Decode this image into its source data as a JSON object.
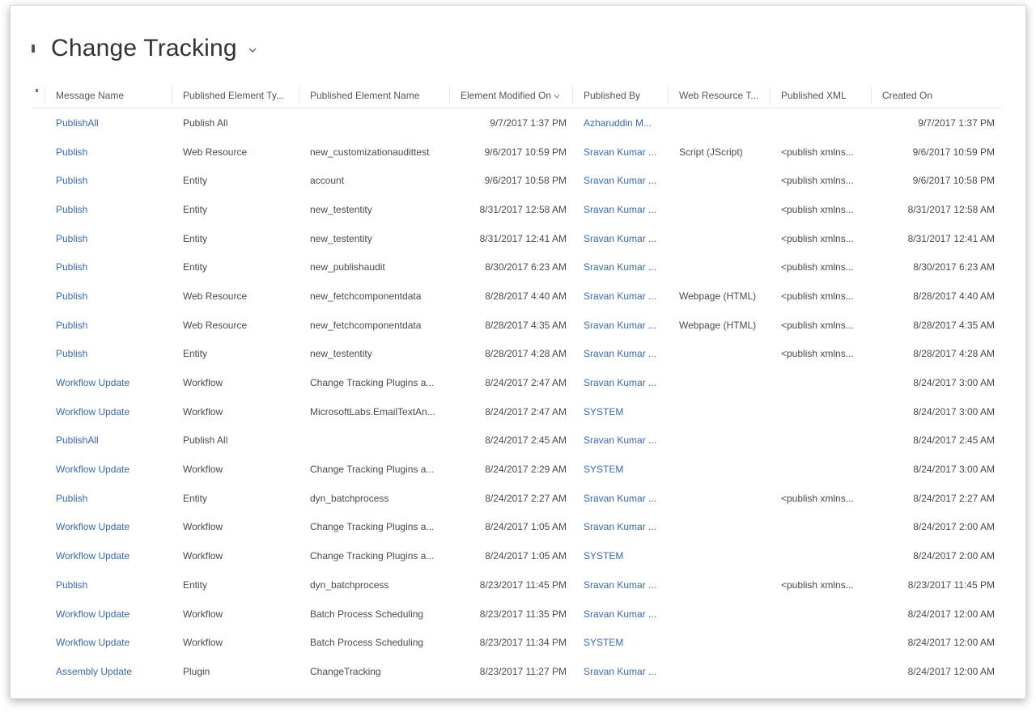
{
  "header": {
    "title": "Change Tracking"
  },
  "columns": [
    "Message Name",
    "Published Element Ty...",
    "Published Element Name",
    "Element Modified On",
    "Published By",
    "Web Resource T...",
    "Published XML",
    "Created On"
  ],
  "rows": [
    [
      "PublishAll",
      "Publish All",
      "",
      "9/7/2017 1:37 PM",
      "Azharuddin M...",
      "",
      "",
      "9/7/2017 1:37 PM"
    ],
    [
      "Publish",
      "Web Resource",
      "new_customizationaudittest",
      "9/6/2017 10:59 PM",
      "Sravan Kumar ...",
      "Script (JScript)",
      "<publish xmlns...",
      "9/6/2017 10:59 PM"
    ],
    [
      "Publish",
      "Entity",
      "account",
      "9/6/2017 10:58 PM",
      "Sravan Kumar ...",
      "",
      "<publish xmlns...",
      "9/6/2017 10:58 PM"
    ],
    [
      "Publish",
      "Entity",
      "new_testentity",
      "8/31/2017 12:58 AM",
      "Sravan Kumar ...",
      "",
      "<publish xmlns...",
      "8/31/2017 12:58 AM"
    ],
    [
      "Publish",
      "Entity",
      "new_testentity",
      "8/31/2017 12:41 AM",
      "Sravan Kumar ...",
      "",
      "<publish xmlns...",
      "8/31/2017 12:41 AM"
    ],
    [
      "Publish",
      "Entity",
      "new_publishaudit",
      "8/30/2017 6:23 AM",
      "Sravan Kumar ...",
      "",
      "<publish xmlns...",
      "8/30/2017 6:23 AM"
    ],
    [
      "Publish",
      "Web Resource",
      "new_fetchcomponentdata",
      "8/28/2017 4:40 AM",
      "Sravan Kumar ...",
      "Webpage (HTML)",
      "<publish xmlns...",
      "8/28/2017 4:40 AM"
    ],
    [
      "Publish",
      "Web Resource",
      "new_fetchcomponentdata",
      "8/28/2017 4:35 AM",
      "Sravan Kumar ...",
      "Webpage (HTML)",
      "<publish xmlns...",
      "8/28/2017 4:35 AM"
    ],
    [
      "Publish",
      "Entity",
      "new_testentity",
      "8/28/2017 4:28 AM",
      "Sravan Kumar ...",
      "",
      "<publish xmlns...",
      "8/28/2017 4:28 AM"
    ],
    [
      "Workflow Update",
      "Workflow",
      "Change Tracking Plugins a...",
      "8/24/2017 2:47 AM",
      "Sravan Kumar ...",
      "",
      "",
      "8/24/2017 3:00 AM"
    ],
    [
      "Workflow Update",
      "Workflow",
      "MicrosoftLabs.EmailTextAn...",
      "8/24/2017 2:47 AM",
      "SYSTEM",
      "",
      "",
      "8/24/2017 3:00 AM"
    ],
    [
      "PublishAll",
      "Publish All",
      "",
      "8/24/2017 2:45 AM",
      "Sravan Kumar ...",
      "",
      "",
      "8/24/2017 2:45 AM"
    ],
    [
      "Workflow Update",
      "Workflow",
      "Change Tracking Plugins a...",
      "8/24/2017 2:29 AM",
      "SYSTEM",
      "",
      "",
      "8/24/2017 3:00 AM"
    ],
    [
      "Publish",
      "Entity",
      "dyn_batchprocess",
      "8/24/2017 2:27 AM",
      "Sravan Kumar ...",
      "",
      "<publish xmlns...",
      "8/24/2017 2:27 AM"
    ],
    [
      "Workflow Update",
      "Workflow",
      "Change Tracking Plugins a...",
      "8/24/2017 1:05 AM",
      "Sravan Kumar ...",
      "",
      "",
      "8/24/2017 2:00 AM"
    ],
    [
      "Workflow Update",
      "Workflow",
      "Change Tracking Plugins a...",
      "8/24/2017 1:05 AM",
      "SYSTEM",
      "",
      "",
      "8/24/2017 2:00 AM"
    ],
    [
      "Publish",
      "Entity",
      "dyn_batchprocess",
      "8/23/2017 11:45 PM",
      "Sravan Kumar ...",
      "",
      "<publish xmlns...",
      "8/23/2017 11:45 PM"
    ],
    [
      "Workflow Update",
      "Workflow",
      "Batch Process Scheduling",
      "8/23/2017 11:35 PM",
      "Sravan Kumar ...",
      "",
      "",
      "8/24/2017 12:00 AM"
    ],
    [
      "Workflow Update",
      "Workflow",
      "Batch Process Scheduling",
      "8/23/2017 11:34 PM",
      "SYSTEM",
      "",
      "",
      "8/24/2017 12:00 AM"
    ],
    [
      "Assembly Update",
      "Plugin",
      "ChangeTracking",
      "8/23/2017 11:27 PM",
      "Sravan Kumar ...",
      "",
      "",
      "8/24/2017 12:00 AM"
    ]
  ],
  "colors": {
    "link": "#3b68b5",
    "text": "#4a4a4a"
  }
}
